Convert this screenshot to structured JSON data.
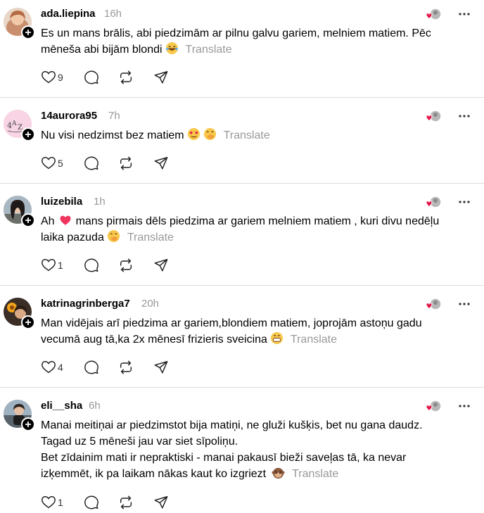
{
  "posts": [
    {
      "username": "ada.liepina",
      "time": "16h",
      "lines": [
        "Es un mans brālis, abi piedzimām ar pilnu galvu gariem, melniem matiem. Pēc",
        "mēneša abi bijām blondi"
      ],
      "translate": "Translate",
      "likes": "9"
    },
    {
      "username": "14aurora95",
      "time": "7h",
      "lines": [
        "Nu visi nedzimst bez matiem"
      ],
      "translate": "Translate",
      "likes": "5"
    },
    {
      "username": "luizebila",
      "time": "1h",
      "lines": [
        "Ah",
        "mans pirmais dēls piedzima ar gariem melniem matiem , kuri divu nedēļu",
        "laika pazuda"
      ],
      "translate": "Translate",
      "likes": "1"
    },
    {
      "username": "katrinagrinberga7",
      "time": "20h",
      "lines": [
        "Man vidējais arī piedzima ar gariem,blondiem matiem, joprojām astoņu gadu",
        "vecumā aug tā,ka 2x mēnesī frizieris sveicina"
      ],
      "translate": "Translate",
      "likes": "4"
    },
    {
      "username": "eli__sha",
      "time": "6h",
      "lines": [
        "Manai meitiņai ar piedzimstot bija matiņi, ne gluži kušķis, bet nu gana daudz.",
        "Tagad uz 5 mēneši jau var siet sīpoliņu.",
        "Bet zīdainim mati ir nepraktiski - manai pakausī bieži saveļas tā, ka nevar",
        "izķemmēt, ik pa laikam nākas kaut ko izgriezt"
      ],
      "translate": "Translate",
      "likes": "1"
    }
  ],
  "icons": {
    "like": "heart-outline-icon",
    "reply": "comment-bubble-icon",
    "repost": "repost-icon",
    "share": "send-icon",
    "more": "more-horizontal-icon",
    "follow": "plus-icon"
  },
  "colors": {
    "muted": "#999999",
    "divider": "#dbdbdb",
    "heart": "#e3174a"
  }
}
